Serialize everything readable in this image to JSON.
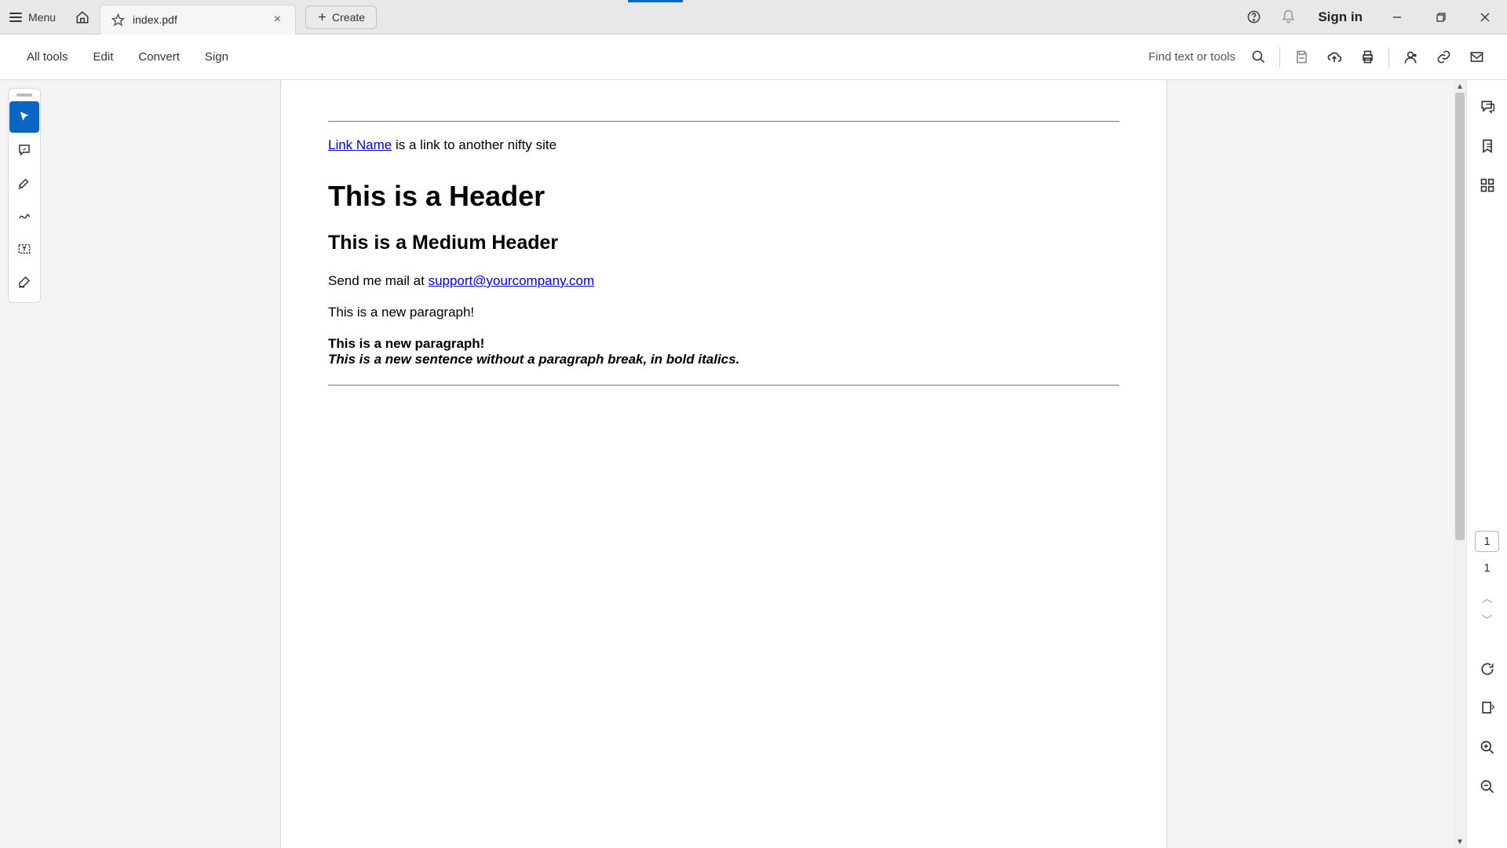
{
  "titlebar": {
    "menu_label": "Menu",
    "tab_title": "index.pdf",
    "create_label": "Create",
    "signin_label": "Sign in"
  },
  "toolbar": {
    "items": [
      "All tools",
      "Edit",
      "Convert",
      "Sign"
    ],
    "find_label": "Find text or tools"
  },
  "document": {
    "link_name": "Link Name",
    "link_inline_text": " is a link to another nifty site",
    "h1": "This is a Header",
    "h2": "This is a Medium Header",
    "mail_prefix": "Send me mail at ",
    "mail_link": "support@yourcompany.com",
    "para1": "This is a new paragraph!",
    "bold_line": "This is a new paragraph!",
    "bolditalic_line": "This is a new sentence without a paragraph break, in bold italics."
  },
  "paging": {
    "current": "1",
    "total": "1"
  }
}
